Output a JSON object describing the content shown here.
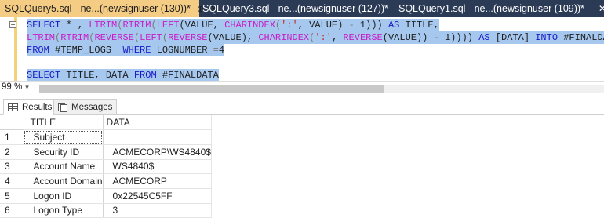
{
  "tabs": [
    {
      "label": "SQLQuery5.sql - ne...(newsignuser (130))*",
      "pin": "⊕",
      "close": "✕"
    },
    {
      "label": "SQLQuery3.sql - ne...(newsignuser (127))*"
    },
    {
      "label": "SQLQuery1.sql - ne...(newsignuser (109))*",
      "close": "✕"
    }
  ],
  "editor": {
    "collapse_glyph": "−",
    "line1": {
      "kw1": "SELECT",
      "t1": " * , ",
      "fn1": "LTRIM",
      "p1": "(",
      "fn2": "RTRIM",
      "p2": "(",
      "fn3": "LEFT",
      "p3": "(VALUE, ",
      "fn4": "CHARINDEX",
      "p4": "(",
      "str1": "':'",
      "p5": ", VALUE) ",
      "op1": "-",
      "p6": " 1))) ",
      "kw2": "AS",
      "p7": " TITLE,"
    },
    "line2": {
      "fn1": "LTRIM",
      "p1": "(",
      "fn2": "RTRIM",
      "p2": "(",
      "fn3": "REVERSE",
      "p3": "(",
      "fn4": "LEFT",
      "p4": "(",
      "fn5": "REVERSE",
      "p5": "(VALUE), ",
      "fn6": "CHARINDEX",
      "p6": "(",
      "str1": "':'",
      "p7": ", ",
      "fn7": "REVERSE",
      "p8": "(VALUE)) ",
      "op1": "-",
      "p9": " 1)))) ",
      "kw1": "AS",
      "p10": " [DATA] ",
      "kw2": "INTO",
      "p11": " #FINALDATA"
    },
    "line3": {
      "kw1": "FROM",
      "p1": " #TEMP_LOGS  ",
      "kw2": "WHERE",
      "p2": " LOGNUMBER ",
      "op1": "=",
      "p3": "4"
    },
    "line5": {
      "kw1": "SELECT",
      "p1": " TITLE, DATA ",
      "kw2": "FROM",
      "p2": " #FINALDATA"
    }
  },
  "zoom": {
    "value": "99 %",
    "caret": "▾"
  },
  "results_tabs": {
    "results": "Results",
    "messages": "Messages"
  },
  "grid": {
    "columns": [
      "TITLE",
      "DATA"
    ],
    "rows": [
      {
        "n": "1",
        "title": "Subject",
        "data": ""
      },
      {
        "n": "2",
        "title": "Security ID",
        "data": "ACMECORP\\WS4840$"
      },
      {
        "n": "3",
        "title": "Account Name",
        "data": "WS4840$"
      },
      {
        "n": "4",
        "title": "Account Domain",
        "data": "ACMECORP"
      },
      {
        "n": "5",
        "title": "Logon ID",
        "data": "0x22545C5FF"
      },
      {
        "n": "6",
        "title": "Logon Type",
        "data": "3"
      }
    ]
  },
  "colors": {
    "tabbar": "#2b3a55",
    "active_tab": "#f5cc84",
    "selection": "#a6c8ee"
  }
}
